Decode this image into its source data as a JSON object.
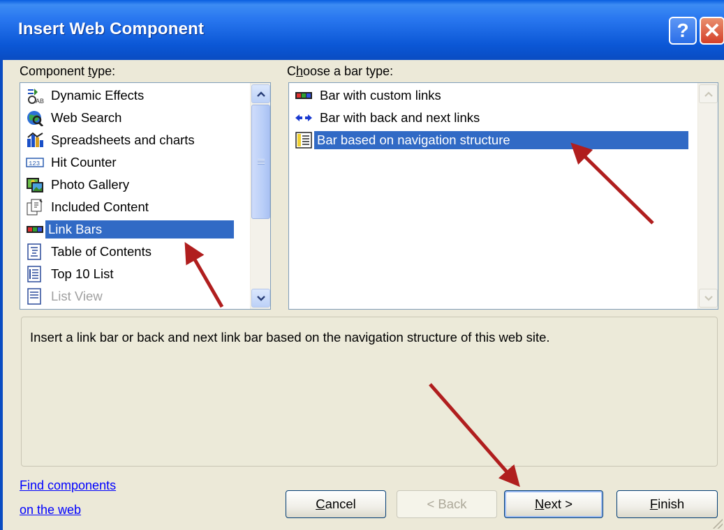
{
  "window": {
    "title": "Insert Web Component",
    "help_icon": "?",
    "close_icon": "✕"
  },
  "component_type": {
    "label_pre": "Component ",
    "label_mnemonic": "t",
    "label_post": "ype:",
    "items": [
      {
        "label": "Dynamic Effects",
        "icon": "dynamic-effects-icon"
      },
      {
        "label": "Web Search",
        "icon": "web-search-icon"
      },
      {
        "label": "Spreadsheets and charts",
        "icon": "spreadsheets-icon"
      },
      {
        "label": "Hit Counter",
        "icon": "hit-counter-icon"
      },
      {
        "label": "Photo Gallery",
        "icon": "photo-gallery-icon"
      },
      {
        "label": "Included Content",
        "icon": "included-content-icon"
      },
      {
        "label": "Link Bars",
        "icon": "link-bars-icon",
        "selected": true
      },
      {
        "label": "Table of Contents",
        "icon": "table-of-contents-icon"
      },
      {
        "label": "Top 10 List",
        "icon": "top-10-list-icon"
      },
      {
        "label": "List View",
        "icon": "list-view-icon",
        "disabled": true
      }
    ]
  },
  "bar_type": {
    "label_pre": "C",
    "label_mnemonic": "h",
    "label_post": "oose a bar type:",
    "items": [
      {
        "label": "Bar with custom links",
        "icon": "custom-links-icon"
      },
      {
        "label": "Bar with back and next links",
        "icon": "back-next-arrows-icon"
      },
      {
        "label": "Bar based on navigation structure",
        "icon": "navigation-structure-icon",
        "selected": true
      }
    ]
  },
  "description": "Insert a link bar or back and next link bar based on the navigation structure of this web site.",
  "footer": {
    "link_line1": "Find components",
    "link_line2": "on the web",
    "cancel_mn": "C",
    "cancel_rest": "ancel",
    "back_label": "< Back",
    "next_mn": "N",
    "next_rest": "ext >",
    "finish_mn": "F",
    "finish_rest": "inish"
  },
  "colors": {
    "titlebar": "#0a5fe0",
    "selection": "#316ac5",
    "annotation_arrow": "#b01e1e",
    "dialog_bg": "#ece9d8"
  }
}
